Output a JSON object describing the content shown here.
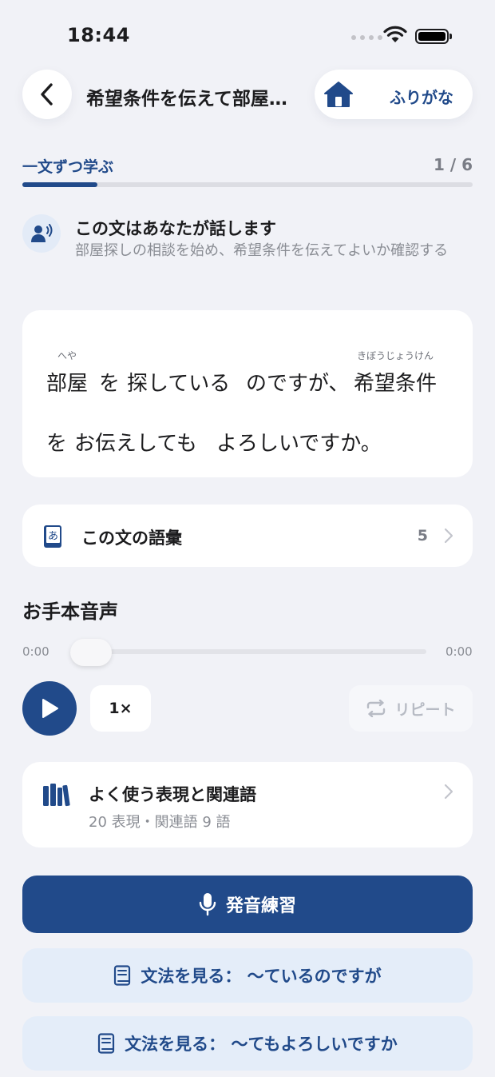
{
  "status_bar": {
    "time": "18:44"
  },
  "header": {
    "back_icon": "chevron-left-icon",
    "title": "希望条件を伝えて部屋…",
    "home_icon": "home-icon",
    "furigana_label": "ふりがな"
  },
  "progress": {
    "mode_label": "一文ずつ学ぶ",
    "counter": "1 / 6",
    "current": 1,
    "total": 6
  },
  "speaker": {
    "icon": "person-speaking-icon",
    "heading": "この文はあなたが話します",
    "description": "部屋探しの相談を始め、希望条件を伝えてよいか確認する"
  },
  "sentence": {
    "words": [
      {
        "text": "部屋",
        "ruby": "へや"
      },
      {
        "text": "を",
        "ruby": ""
      },
      {
        "text": "探している",
        "ruby": ""
      },
      {
        "text": "のですが、",
        "ruby": ""
      },
      {
        "text": "希望条件",
        "ruby": "きぼうじょうけん"
      },
      {
        "text": "を",
        "ruby": ""
      },
      {
        "text": "お伝えしても",
        "ruby": ""
      },
      {
        "text": "よろしいですか。",
        "ruby": ""
      }
    ]
  },
  "vocab": {
    "icon": "dictionary-icon",
    "label": "この文の語彙",
    "count": "5"
  },
  "audio": {
    "heading": "お手本音声",
    "time_current": "0:00",
    "time_total": "0:00",
    "position_fraction": 0,
    "speed_label": "1×",
    "repeat_label": "リピート"
  },
  "expressions": {
    "icon": "books-icon",
    "title": "よく使う表現と関連語",
    "subtitle": "20 表現・関連語 9 語"
  },
  "actions": {
    "practice_label": "発音練習",
    "grammar_1_label": "文法を見る： 〜ているのですが",
    "grammar_2_label": "文法を見る： 〜てもよろしいですか"
  },
  "colors": {
    "accent": "#214a8a",
    "background": "#f1f2f7",
    "light_accent": "#e4edf9"
  }
}
